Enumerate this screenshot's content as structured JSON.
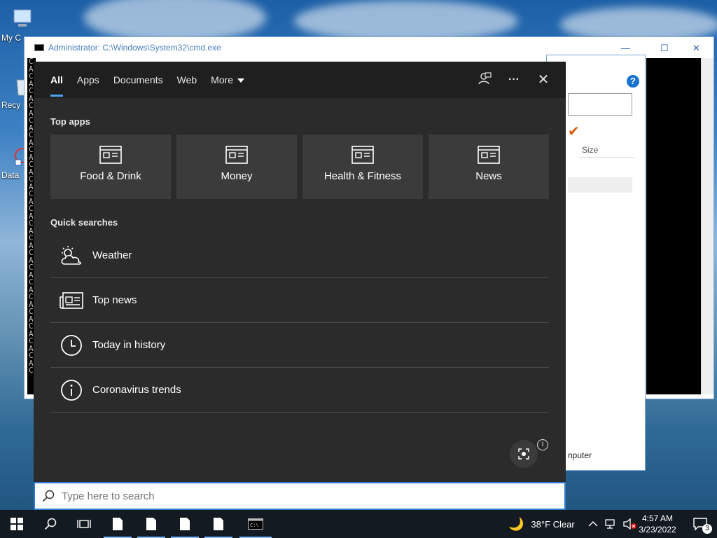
{
  "desktop": {
    "icons": [
      {
        "label": "My C"
      },
      {
        "label": "Recy"
      },
      {
        "label": "Data"
      }
    ]
  },
  "cmd_window": {
    "title": "Administrator: C:\\Windows\\System32\\cmd.exe",
    "letters": "C A C A C A C A C A C A C A C A C A C A C A C A C A C A C A C A C A C A C A C A C A C",
    "minimize": "—",
    "maximize": "☐",
    "close": "✕"
  },
  "explorer": {
    "size_header": "Size",
    "status": "nputer",
    "help": "?"
  },
  "search_panel": {
    "tabs": [
      {
        "label": "All"
      },
      {
        "label": "Apps"
      },
      {
        "label": "Documents"
      },
      {
        "label": "Web"
      },
      {
        "label": "More"
      }
    ],
    "more_icon": "···",
    "close_icon": "✕",
    "top_apps_title": "Top apps",
    "top_apps": [
      {
        "label": "Food & Drink"
      },
      {
        "label": "Money"
      },
      {
        "label": "Health & Fitness"
      },
      {
        "label": "News"
      }
    ],
    "quick_title": "Quick searches",
    "quick": [
      {
        "label": "Weather",
        "icon": "weather-icon"
      },
      {
        "label": "Top news",
        "icon": "news-icon"
      },
      {
        "label": "Today in history",
        "icon": "clock-icon"
      },
      {
        "label": "Coronavirus trends",
        "icon": "info-icon"
      }
    ]
  },
  "search_box": {
    "placeholder": "Type here to search"
  },
  "taskbar": {
    "weather": "38°F  Clear",
    "time": "4:57 AM",
    "date": "3/23/2022",
    "notifications": "3"
  }
}
